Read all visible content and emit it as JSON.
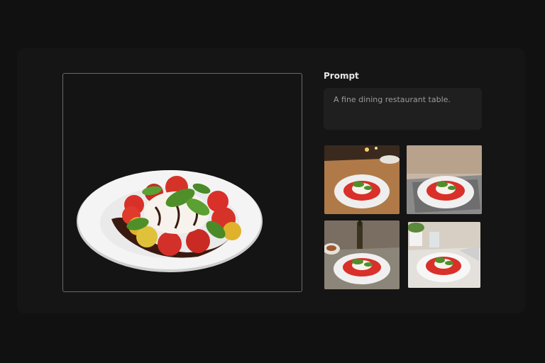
{
  "prompt": {
    "label": "Prompt",
    "text": "A fine dining restaurant table."
  },
  "main_image": {
    "icon": "caprese-salad-plate-image"
  },
  "results": [
    {
      "icon": "generated-image-1",
      "scene": "warm wooden table with candles"
    },
    {
      "icon": "generated-image-2",
      "scene": "beige wall with gray placemat"
    },
    {
      "icon": "generated-image-3",
      "scene": "table with wine bottle"
    },
    {
      "icon": "generated-image-4",
      "scene": "bright table with plant and glass"
    }
  ],
  "colors": {
    "background": "#111111",
    "panel": "#151515",
    "prompt_box": "#1f1f1f"
  }
}
